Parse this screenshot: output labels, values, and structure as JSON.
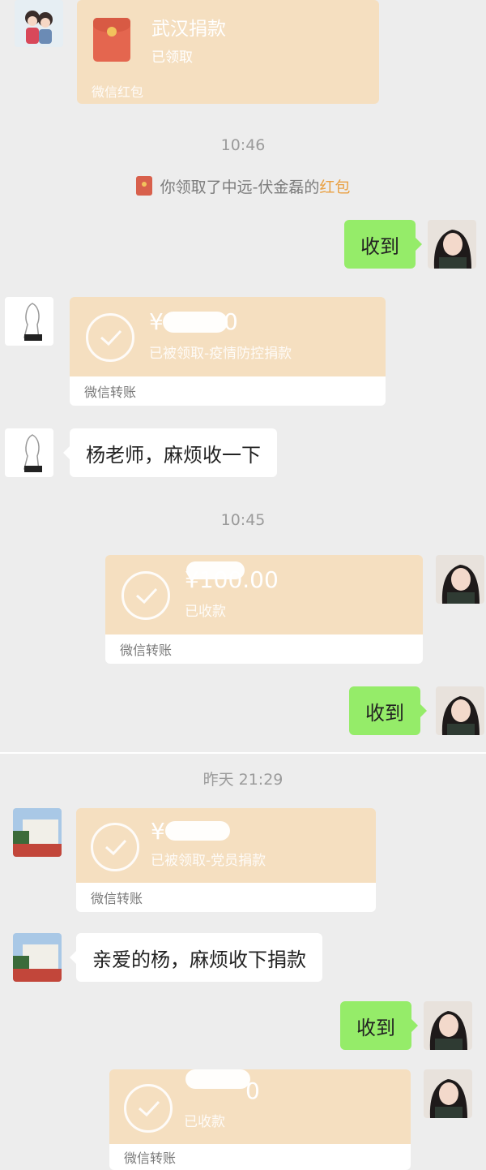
{
  "cards": {
    "red_packet": {
      "title": "武汉捐款",
      "status": "已领取",
      "footer": "微信红包"
    },
    "transfer1": {
      "amount": "¥",
      "tail": "0",
      "status": "已被领取-疫情防控捐款",
      "footer": "微信转账"
    },
    "transfer2": {
      "amount": "¥100.00",
      "status": "已收款",
      "footer": "微信转账"
    },
    "transfer3": {
      "amount": "¥",
      "status": "已被领取-党员捐款",
      "footer": "微信转账"
    },
    "transfer4": {
      "tail": "0",
      "status": "已收款",
      "footer": "微信转账"
    }
  },
  "timestamps": {
    "t1": "10:46",
    "t2": "10:45",
    "t3": "昨天 21:29"
  },
  "system": {
    "prefix": "你领取了中远-伏金磊的",
    "link": "红包"
  },
  "messages": {
    "ack1": "收到",
    "msg1": "杨老师，麻烦收一下",
    "ack2": "收到",
    "msg2": "亲爱的杨，麻烦收下捐款",
    "ack3": "收到"
  },
  "colors": {
    "card": "#f5dfc0",
    "self_bubble": "#95ec69",
    "red_packet_link": "#e9a042",
    "background": "#ededed"
  }
}
